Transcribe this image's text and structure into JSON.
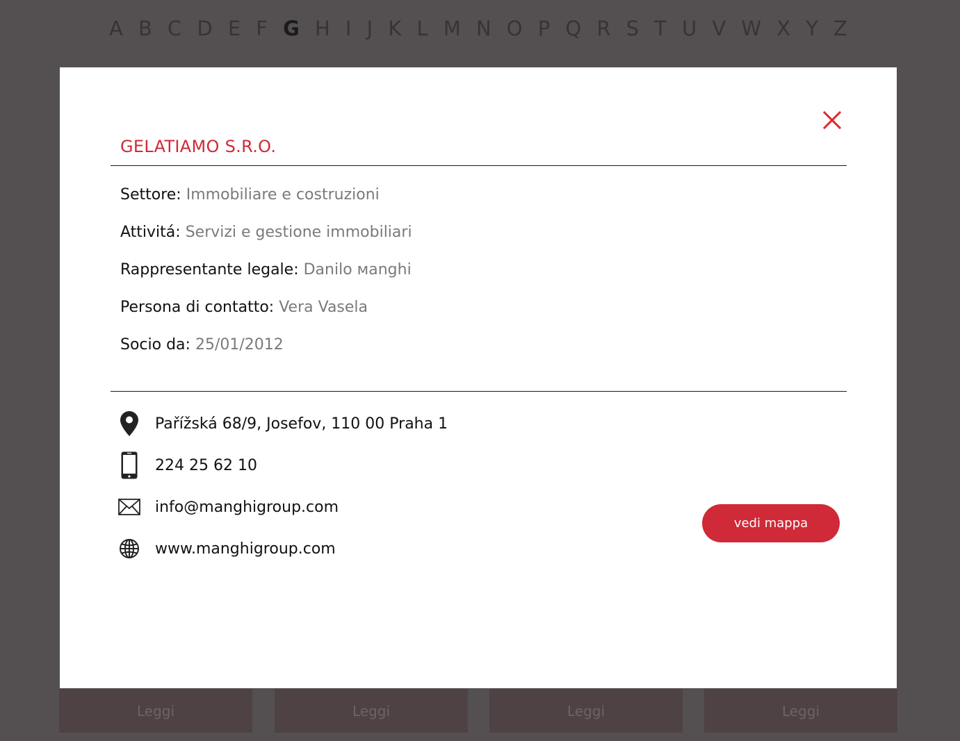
{
  "alphabet": {
    "letters": [
      "A",
      "B",
      "C",
      "D",
      "E",
      "F",
      "G",
      "H",
      "I",
      "J",
      "K",
      "L",
      "M",
      "N",
      "O",
      "P",
      "Q",
      "R",
      "S",
      "T",
      "U",
      "V",
      "W",
      "X",
      "Y",
      "Z"
    ],
    "active": "G"
  },
  "cards": {
    "read_labels": [
      "Leggi",
      "Leggi",
      "Leggi",
      "Leggi"
    ]
  },
  "modal": {
    "title": "GELATIAMO S.R.O.",
    "close_icon": "close-x-icon",
    "accent_color": "#d02937",
    "details": {
      "sector_label": "Settore:",
      "sector_value": "Immobiliare e costruzioni",
      "activity_label": "Attivitá:",
      "activity_value": "Servizi e gestione immobiliari",
      "legal_rep_label": "Rappresentante legale:",
      "legal_rep_value": "Danilo мanghi",
      "contact_label": "Persona di contatto:",
      "contact_value": "Vera Vasela",
      "member_since_label": "Socio da:",
      "member_since_value": "25/01/2012"
    },
    "contacts": {
      "address": "Pařížská 68/9, Josefov, 110 00 Praha 1",
      "phone": "224 25 62 10",
      "email": "info@manghigroup.com",
      "website": "www.manghigroup.com"
    },
    "map_button_label": "vedi mappa"
  }
}
